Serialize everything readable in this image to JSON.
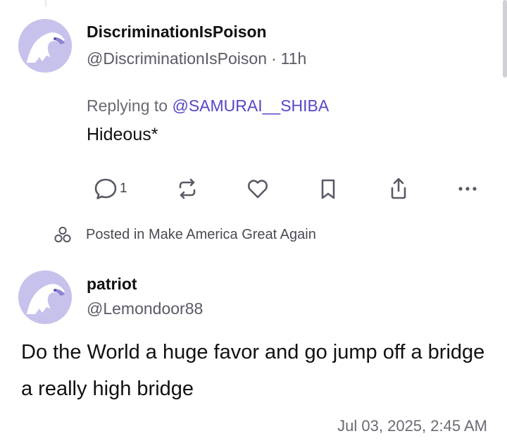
{
  "reply_post": {
    "display_name": "DiscriminationIsPoison",
    "handle": "@DiscriminationIsPoison",
    "separator": "·",
    "time_ago": "11h",
    "replying_prefix": "Replying to",
    "replying_to": "@SAMURAI__SHIBA",
    "text": "Hideous*",
    "actions": {
      "comment_count": "1",
      "icons": [
        "comment-icon",
        "repost-icon",
        "heart-icon",
        "bookmark-icon",
        "share-icon",
        "more-icon"
      ]
    }
  },
  "posted_in": {
    "icon": "group-icon",
    "text": "Posted in Make America Great Again"
  },
  "main_post": {
    "display_name": "patriot",
    "handle": "@Lemondoor88",
    "text": "Do the World a huge favor and go jump off a bridge a really high bridge",
    "timestamp": "Jul 03, 2025, 2:45 AM"
  },
  "colors": {
    "mention": "#5547c6",
    "avatar_bg": "#c7c2ec",
    "muted_text": "#6a6a74"
  }
}
